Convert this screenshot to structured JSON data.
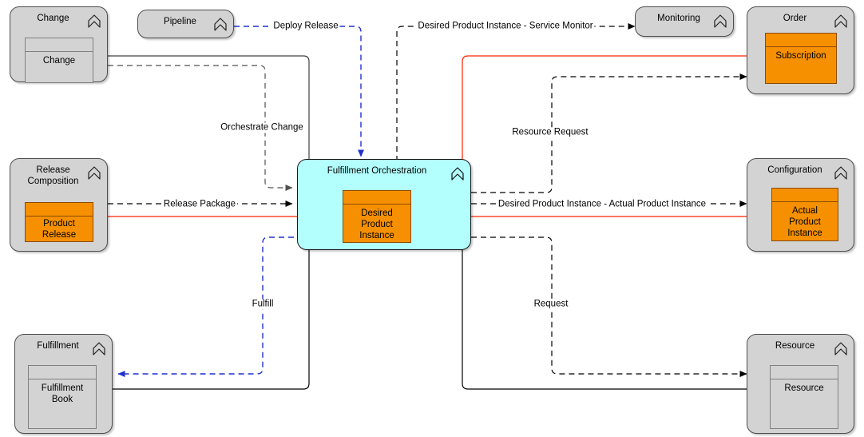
{
  "diagram": {
    "title": "Fulfillment Orchestration",
    "colors": {
      "grouping_fill": "#d3d3d3",
      "accent_fill": "#b2fffd",
      "object_fill": "#f79000",
      "edge_black": "#000000",
      "edge_blue": "#2030d0",
      "edge_red": "#ff2000",
      "edge_gray": "#404040"
    }
  },
  "nodes": [
    {
      "id": "change",
      "title": "Change",
      "glyph": "grouping-chevron-icon",
      "fill": "#d3d3d3",
      "inner": {
        "label": "Change",
        "fill": "#d3d3d3"
      }
    },
    {
      "id": "pipeline",
      "title": "Pipeline",
      "glyph": "grouping-chevron-icon",
      "fill": "#d3d3d3",
      "inner": null
    },
    {
      "id": "monitoring",
      "title": "Monitoring",
      "glyph": "grouping-chevron-icon",
      "fill": "#d3d3d3",
      "inner": null
    },
    {
      "id": "order",
      "title": "Order",
      "glyph": "grouping-chevron-icon",
      "fill": "#d3d3d3",
      "inner": {
        "label": "Subscription",
        "fill": "#f79000"
      }
    },
    {
      "id": "release-composition",
      "title": "Release\nComposition",
      "glyph": "grouping-chevron-icon",
      "fill": "#d3d3d3",
      "inner": {
        "label": "Product\nRelease",
        "fill": "#f79000"
      }
    },
    {
      "id": "fulfillment-orchestration",
      "title": "Fulfillment Orchestration",
      "glyph": "grouping-chevron-icon",
      "fill": "#b2fffd",
      "inner": {
        "label": "Desired\nProduct\nInstance",
        "fill": "#f79000"
      }
    },
    {
      "id": "configuration",
      "title": "Configuration",
      "glyph": "grouping-chevron-icon",
      "fill": "#d3d3d3",
      "inner": {
        "label": "Actual\nProduct\nInstance",
        "fill": "#f79000"
      }
    },
    {
      "id": "fulfillment",
      "title": "Fulfillment",
      "glyph": "grouping-chevron-icon",
      "fill": "#d3d3d3",
      "inner": {
        "label": "Fulfillment\nBook",
        "fill": "#d3d3d3"
      }
    },
    {
      "id": "resource",
      "title": "Resource",
      "glyph": "grouping-chevron-icon",
      "fill": "#d3d3d3",
      "inner": {
        "label": "Resource",
        "fill": "#d3d3d3"
      }
    }
  ],
  "edges": [
    {
      "id": "deploy-release",
      "label": "Deploy Release",
      "from": "pipeline",
      "to": "fulfillment-orchestration",
      "style": "dashed",
      "color": "#2030d0",
      "arrow": true
    },
    {
      "id": "desired-product-instance-service-monitor",
      "label": "Desired Product Instance - Service Monitor",
      "from": "fulfillment-orchestration",
      "to": "monitoring",
      "style": "dashed",
      "color": "#000000",
      "arrow": true
    },
    {
      "id": "orchestrate-change",
      "label": "Orchestrate Change",
      "from": "change",
      "to": "fulfillment-orchestration",
      "style": "dashed",
      "color": "#404040",
      "arrow": true
    },
    {
      "id": "release-package",
      "label": "Release Package",
      "from": "release-composition",
      "to": "fulfillment-orchestration",
      "style": "dashed",
      "color": "#000000",
      "arrow": true
    },
    {
      "id": "resource-request",
      "label": "Resource Request",
      "from": "fulfillment-orchestration",
      "to": "order",
      "style": "dashed",
      "color": "#000000",
      "arrow": true
    },
    {
      "id": "desired-product-instance-actual-product-instance",
      "label": "Desired Product Instance - Actual Product Instance",
      "from": "fulfillment-orchestration",
      "to": "configuration",
      "style": "dashed",
      "color": "#000000",
      "arrow": true
    },
    {
      "id": "fulfill",
      "label": "Fulfill",
      "from": "fulfillment-orchestration",
      "to": "fulfillment",
      "style": "dashed",
      "color": "#2030d0",
      "arrow": true
    },
    {
      "id": "request",
      "label": "Request",
      "from": "fulfillment-orchestration",
      "to": "resource",
      "style": "dashed",
      "color": "#000000",
      "arrow": true
    },
    {
      "id": "change-association",
      "label": "",
      "from": "change",
      "to": "fulfillment-orchestration",
      "style": "solid",
      "color": "#404040",
      "arrow": false
    },
    {
      "id": "subscription-realization",
      "label": "",
      "from": "order",
      "to": "fulfillment-orchestration",
      "style": "solid",
      "color": "#ff2000",
      "arrow": false
    },
    {
      "id": "product-release-realization",
      "label": "",
      "from": "release-composition",
      "to": "fulfillment-orchestration",
      "style": "solid",
      "color": "#ff2000",
      "arrow": false
    },
    {
      "id": "actual-product-instance-realization",
      "label": "",
      "from": "fulfillment-orchestration",
      "to": "configuration",
      "style": "solid",
      "color": "#ff2000",
      "arrow": false
    },
    {
      "id": "fulfillment-book-association",
      "label": "",
      "from": "fulfillment",
      "to": "fulfillment-orchestration",
      "style": "solid",
      "color": "#000000",
      "arrow": false
    },
    {
      "id": "resource-association",
      "label": "",
      "from": "resource",
      "to": "fulfillment-orchestration",
      "style": "solid",
      "color": "#000000",
      "arrow": false
    }
  ]
}
